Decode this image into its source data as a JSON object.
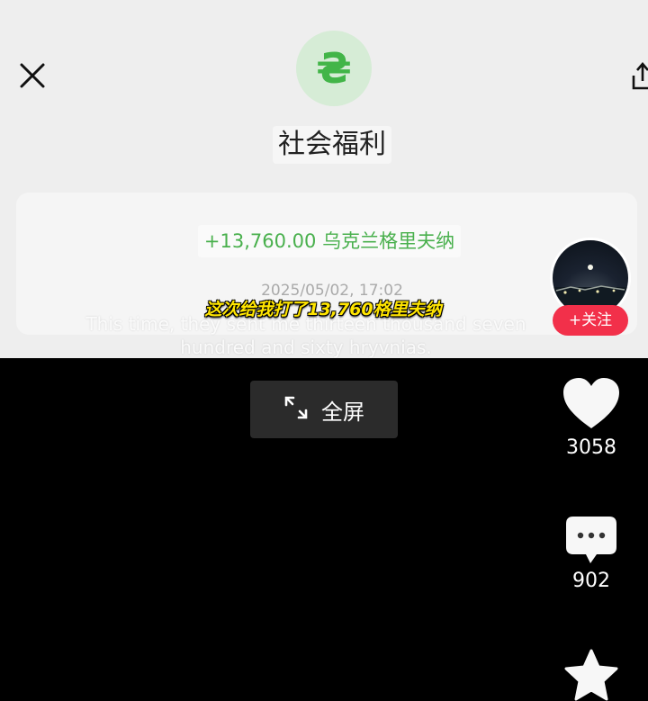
{
  "video": {
    "app_title": "社会福利",
    "amount_text": "+13,760.00 乌克兰格里夫纳",
    "datetime": "2025/05/02, 17:02",
    "subtitle_zh": "这次给我打了13,760格里夫纳",
    "subtitle_en": "This time, they sent me thirteen thousand seven hundred and sixty hryvnias.",
    "currency_symbol": "₴"
  },
  "author": {
    "follow_label": "+关注"
  },
  "controls": {
    "fullscreen_label": "全屏"
  },
  "actions": {
    "like_count": "3058",
    "comment_count": "902"
  },
  "colors": {
    "accent_green": "#49b04d",
    "follow_red": "#f2304a",
    "subtitle_yellow": "#ffe500"
  },
  "icons": [
    "close-icon",
    "share-icon",
    "currency-icon",
    "expand-icon",
    "heart-icon",
    "comment-icon",
    "star-icon"
  ]
}
